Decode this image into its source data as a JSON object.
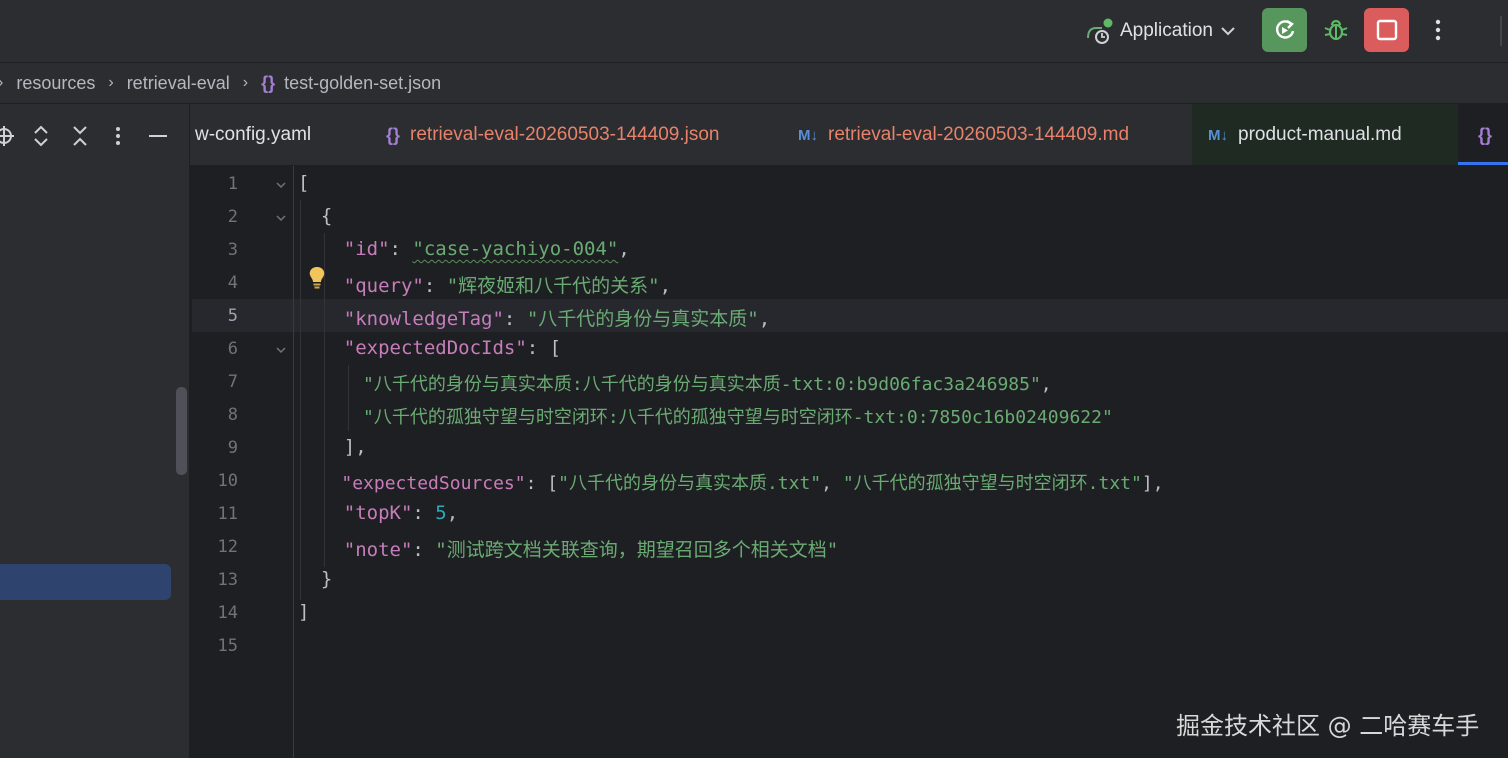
{
  "toolbar": {
    "run_config": "Application",
    "icons": [
      "application-run-config-icon",
      "rerun-icon",
      "debug-bug-icon",
      "stop-icon",
      "more-vertical-icon"
    ],
    "colors": {
      "run": "#57965c",
      "stop": "#db5c5c"
    }
  },
  "breadcrumb": {
    "items": [
      "resources",
      "retrieval-eval",
      "test-golden-set.json"
    ]
  },
  "tabs": [
    {
      "label": "w-config.yaml",
      "icon": "",
      "color": "#dfe1e5"
    },
    {
      "label": "retrieval-eval-20260503-144409.json",
      "icon": "{}",
      "color": "#e8826a"
    },
    {
      "label": "retrieval-eval-20260503-144409.md",
      "icon": "M↓",
      "color": "#e8826a"
    },
    {
      "label": "product-manual.md",
      "icon": "M↓",
      "color": "#dfe1e5"
    },
    {
      "label": "",
      "icon": "{}",
      "color": "#dfe1e5"
    }
  ],
  "editor": {
    "current_line": 5,
    "line_numbers": [
      "1",
      "2",
      "3",
      "4",
      "5",
      "6",
      "7",
      "8",
      "9",
      "10",
      "11",
      "12",
      "13",
      "14",
      "15"
    ],
    "tokens": {
      "l1": [
        "["
      ],
      "l2": [
        "{"
      ],
      "l3": [
        "\"id\"",
        ": ",
        "\"case-yachiyo-004\"",
        ","
      ],
      "l4": [
        "\"query\"",
        ": ",
        "\"辉夜姬和八千代的关系\"",
        ","
      ],
      "l5": [
        "\"knowledgeTag\"",
        ": ",
        "\"八千代的身份与真实本质\"",
        ","
      ],
      "l6": [
        "\"expectedDocIds\"",
        ": ["
      ],
      "l7": [
        "\"八千代的身份与真实本质:八千代的身份与真实本质-txt:0:b9d06fac3a246985\"",
        ","
      ],
      "l8": [
        "\"八千代的孤独守望与时空闭环:八千代的孤独守望与时空闭环-txt:0:7850c16b02409622\""
      ],
      "l9": [
        "],"
      ],
      "l10": [
        "\"expectedSources\"",
        ": [",
        "\"八千代的身份与真实本质.txt\"",
        ", ",
        "\"八千代的孤独守望与时空闭环.txt\"",
        "],"
      ],
      "l11": [
        "\"topK\"",
        ": ",
        "5",
        ","
      ],
      "l12": [
        "\"note\"",
        ": ",
        "\"测试跨文档关联查询，期望召回多个相关文档\""
      ],
      "l13": [
        "}"
      ],
      "l14": [
        "]"
      ]
    }
  },
  "watermark": "掘金技术社区 @ 二哈赛车手"
}
